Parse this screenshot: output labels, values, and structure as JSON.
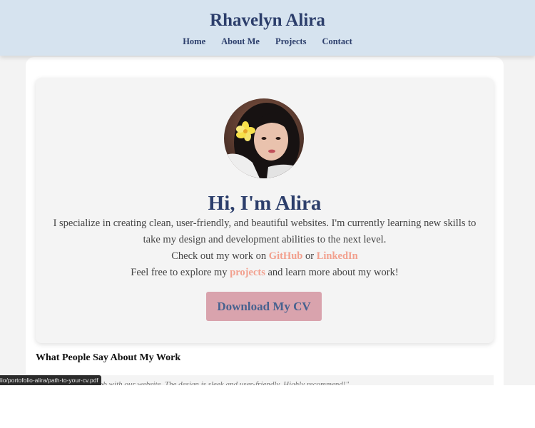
{
  "header": {
    "title": "Rhavelyn Alira",
    "nav": [
      {
        "label": "Home"
      },
      {
        "label": "About Me"
      },
      {
        "label": "Projects"
      },
      {
        "label": "Contact"
      }
    ]
  },
  "hero": {
    "greeting": "Hi, I'm Alira",
    "intro": "I specialize in creating clean, user-friendly, and beautiful websites. I'm currently learning new skills to take my design and development abilities to the next level.",
    "work_prefix": "Check out my work on ",
    "github_label": "GitHub",
    "work_or": " or ",
    "linkedin_label": "LinkedIn",
    "explore_prefix": "Feel free to explore my ",
    "projects_label": "projects",
    "explore_suffix": " and learn more about my work!",
    "cv_button_label": "Download My CV"
  },
  "testimonials": {
    "heading": "What People Say About My Work",
    "items": [
      {
        "quote": "\"Amazing job with our website. The design is sleek and user-friendly. Highly recommend!\""
      }
    ]
  },
  "status_bar": {
    "url": "lio/portofolio-alira/path-to-your-cv.pdf"
  },
  "colors": {
    "header_bg": "#d6e3ef",
    "title_navy": "#2c3e6b",
    "link_peach": "#f2a08e",
    "button_pink": "#d9a3ad",
    "button_text": "#47628f"
  }
}
